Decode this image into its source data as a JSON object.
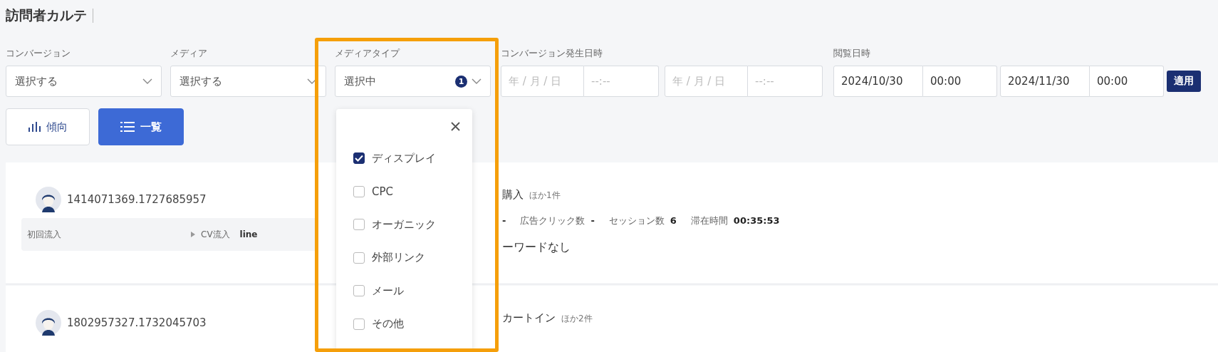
{
  "page": {
    "title": "訪問者カルテ"
  },
  "filters": [
    {
      "kind": "select",
      "label": "コンバージョン",
      "value": "選択する"
    },
    {
      "kind": "select",
      "label": "メディア",
      "value": "選択する"
    },
    {
      "kind": "select",
      "label": "メディアタイプ",
      "value": "選択中",
      "badge": "1",
      "expanded": true
    },
    {
      "kind": "datetime_range",
      "label": "コンバージョン発生日時",
      "ranges": [
        {
          "date": {
            "placeholder": "年 / 月 / 日"
          },
          "time": {
            "placeholder": "--:--"
          }
        },
        {
          "date": {
            "placeholder": "年 / 月 / 日"
          },
          "time": {
            "placeholder": "--:--"
          }
        }
      ]
    },
    {
      "kind": "datetime_range",
      "label": "閲覧日時",
      "ranges": [
        {
          "date": {
            "value": "2024/10/30"
          },
          "time": {
            "value": "00:00"
          }
        },
        {
          "date": {
            "value": "2024/11/30"
          },
          "time": {
            "value": "00:00"
          }
        }
      ]
    }
  ],
  "apply_button": "適用",
  "view_tabs": [
    {
      "kind": "trend",
      "label": "傾向",
      "selected": false
    },
    {
      "kind": "list",
      "label": "一覧",
      "selected": true
    }
  ],
  "media_type_dropdown": {
    "options": [
      {
        "label": "ディスプレイ",
        "checked": true
      },
      {
        "label": "CPC",
        "checked": false
      },
      {
        "label": "オーガニック",
        "checked": false
      },
      {
        "label": "外部リンク",
        "checked": false
      },
      {
        "label": "メール",
        "checked": false
      },
      {
        "label": "その他",
        "checked": false
      }
    ]
  },
  "visitors": [
    {
      "id": "1414071369.1727685957",
      "inflow": {
        "first_label": "初回流入",
        "cv_label": "CV流入",
        "cv_value": "line"
      },
      "conversion": "購入",
      "conversion_more": "ほか1件",
      "stats": [
        {
          "value": "-"
        },
        {
          "label": "広告クリック数",
          "value": "-"
        },
        {
          "label": "セッション数",
          "value": "6"
        },
        {
          "label": "滞在時間",
          "value": "00:35:53"
        }
      ],
      "keyword": "ーワードなし"
    },
    {
      "id": "1802957327.1732045703",
      "conversion": "カートイン",
      "conversion_more": "ほか2件"
    }
  ]
}
